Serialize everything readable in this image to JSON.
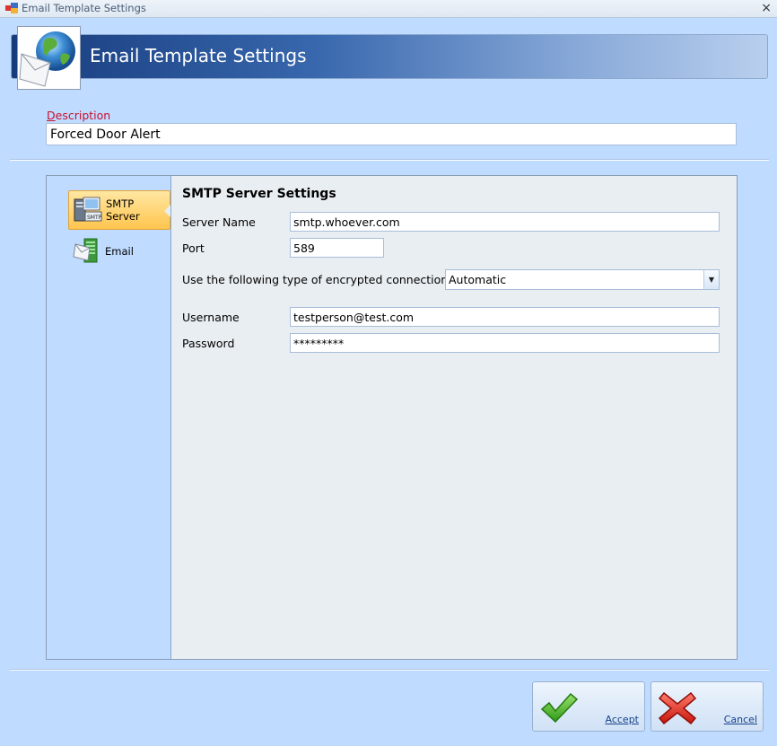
{
  "window": {
    "title": "Email Template Settings",
    "close_glyph": "×"
  },
  "header": {
    "title": "Email Template Settings",
    "icon": "email-globe-icon"
  },
  "description": {
    "label_first": "D",
    "label_rest": "escription",
    "value": "Forced Door Alert"
  },
  "nav": {
    "items": [
      {
        "label": "SMTP Server",
        "icon": "smtp-server-icon",
        "active": true
      },
      {
        "label": "Email",
        "icon": "email-icon",
        "active": false
      }
    ]
  },
  "smtp": {
    "title": "SMTP Server Settings",
    "server_name_label": "Server Name",
    "server_name": "smtp.whoever.com",
    "port_label": "Port",
    "port": "589",
    "encryption_label": "Use the following type of encrypted connection:",
    "encryption_value": "Automatic",
    "username_label": "Username",
    "username": "testperson@test.com",
    "password_label": "Password",
    "password": "*********"
  },
  "buttons": {
    "accept": "Accept",
    "cancel": "Cancel"
  },
  "colors": {
    "accent": "#c8102e",
    "background": "#bfdbff",
    "active_nav": "#ffc54e"
  }
}
